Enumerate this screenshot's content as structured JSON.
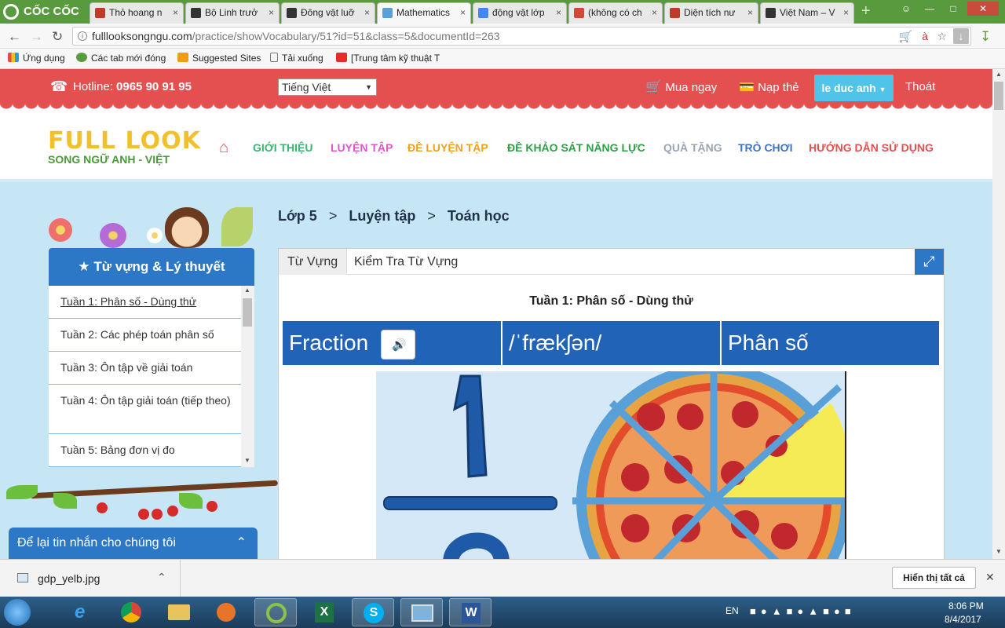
{
  "browser": {
    "brand": "CỐC CỐC",
    "tabs": [
      {
        "title": "Thỏ hoang n",
        "icon": "book-icon",
        "color": "#c0392b"
      },
      {
        "title": "Bộ Linh trưở",
        "icon": "wikipedia-icon",
        "color": "#333333"
      },
      {
        "title": "Đông vật luỡ",
        "icon": "wikipedia-icon",
        "color": "#333333"
      },
      {
        "title": "Mathematics",
        "icon": "site-icon",
        "color": "#5aa0d8"
      },
      {
        "title": "động vật lớp",
        "icon": "google-icon",
        "color": "#4285f4"
      },
      {
        "title": "(không có ch",
        "icon": "gmail-icon",
        "color": "#d44638"
      },
      {
        "title": "Diện tích nư",
        "icon": "tab-icon",
        "color": "#c0392b"
      },
      {
        "title": "Việt Nam – V",
        "icon": "wikipedia-icon",
        "color": "#333333"
      }
    ],
    "url_host": "fulllooksongngu.com",
    "url_path": "/practice/showVocabulary/51?id=51&class=5&documentId=263",
    "bookmarks": [
      "Ứng dụng",
      "Các tab mới đóng",
      "Suggested Sites",
      "Tải xuống",
      "[Trung tâm kỹ thuật T"
    ]
  },
  "site": {
    "hotline_label": "Hotline:",
    "hotline_number": "0965 90 91 95",
    "language": "Tiếng Việt",
    "buy_now": "Mua ngay",
    "top_up": "Nạp thẻ",
    "user": "le duc anh",
    "logout": "Thoát",
    "logo_line1": "FULL LOOK",
    "logo_line2": "SONG NGỮ ANH - VIỆT",
    "nav": [
      {
        "label": "GIỚI THIỆU",
        "color": "#3cb371"
      },
      {
        "label": "LUYỆN TẬP",
        "color": "#e056c9"
      },
      {
        "label": "ĐỀ LUYỆN TẬP",
        "color": "#f0a020"
      },
      {
        "label": "ĐỀ KHẢO SÁT NĂNG LỰC",
        "color": "#2f9e44"
      },
      {
        "label": "QUÀ TẶNG",
        "color": "#9aa5b1"
      },
      {
        "label": "TRÒ CHƠI",
        "color": "#3e73c6"
      },
      {
        "label": "HƯỚNG DẪN SỬ DỤNG",
        "color": "#e3504f"
      }
    ]
  },
  "breadcrumb": {
    "level": "Lớp 5",
    "section": "Luyện tập",
    "subject": "Toán học",
    "sep": ">"
  },
  "sidebar": {
    "title": "Từ vựng & Lý thuyết",
    "items": [
      "Tuần 1: Phân số - Dùng thử",
      "Tuần 2: Các phép toán phân số",
      "Tuần 3: Ôn tập về giải toán",
      "Tuần 4: Ôn tập giải toán (tiếp theo)",
      "Tuần 5: Bảng đơn vị đo"
    ]
  },
  "panel": {
    "tabs": [
      "Từ Vựng",
      "Kiểm Tra Từ Vựng"
    ],
    "week_title": "Tuần 1: Phân số - Dùng thử",
    "word": "Fraction",
    "phonetic": "/ˈfrækʃən/",
    "meaning": "Phân số"
  },
  "chat": {
    "label": "Để lại tin nhắn cho chúng tôi"
  },
  "download": {
    "file": "gdp_yelb.jpg",
    "show_all": "Hiển thị tất cả"
  },
  "taskbar": {
    "lang": "EN",
    "time": "8:06 PM",
    "date": "8/4/2017"
  }
}
